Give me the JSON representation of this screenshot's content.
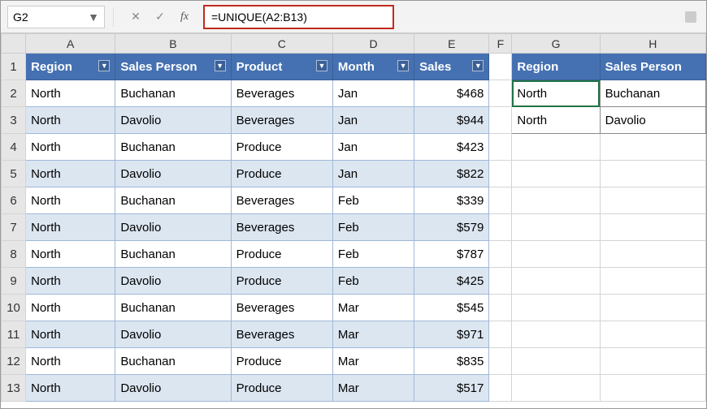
{
  "formula_bar": {
    "active_cell": "G2",
    "formula": "=UNIQUE(A2:B13)",
    "fx_label": "fx"
  },
  "columns": [
    "A",
    "B",
    "C",
    "D",
    "E",
    "F",
    "G",
    "H"
  ],
  "table1_headers": {
    "a": "Region",
    "b": "Sales Person",
    "c": "Product",
    "d": "Month",
    "e": "Sales"
  },
  "table2_headers": {
    "g": "Region",
    "h": "Sales Person"
  },
  "rows": [
    {
      "n": 2,
      "a": "North",
      "b": "Buchanan",
      "c": "Beverages",
      "d": "Jan",
      "e": "$468",
      "g": "North",
      "h": "Buchanan"
    },
    {
      "n": 3,
      "a": "North",
      "b": "Davolio",
      "c": "Beverages",
      "d": "Jan",
      "e": "$944",
      "g": "North",
      "h": "Davolio"
    },
    {
      "n": 4,
      "a": "North",
      "b": "Buchanan",
      "c": "Produce",
      "d": "Jan",
      "e": "$423",
      "g": "",
      "h": ""
    },
    {
      "n": 5,
      "a": "North",
      "b": "Davolio",
      "c": "Produce",
      "d": "Jan",
      "e": "$822",
      "g": "",
      "h": ""
    },
    {
      "n": 6,
      "a": "North",
      "b": "Buchanan",
      "c": "Beverages",
      "d": "Feb",
      "e": "$339",
      "g": "",
      "h": ""
    },
    {
      "n": 7,
      "a": "North",
      "b": "Davolio",
      "c": "Beverages",
      "d": "Feb",
      "e": "$579",
      "g": "",
      "h": ""
    },
    {
      "n": 8,
      "a": "North",
      "b": "Buchanan",
      "c": "Produce",
      "d": "Feb",
      "e": "$787",
      "g": "",
      "h": ""
    },
    {
      "n": 9,
      "a": "North",
      "b": "Davolio",
      "c": "Produce",
      "d": "Feb",
      "e": "$425",
      "g": "",
      "h": ""
    },
    {
      "n": 10,
      "a": "North",
      "b": "Buchanan",
      "c": "Beverages",
      "d": "Mar",
      "e": "$545",
      "g": "",
      "h": ""
    },
    {
      "n": 11,
      "a": "North",
      "b": "Davolio",
      "c": "Beverages",
      "d": "Mar",
      "e": "$971",
      "g": "",
      "h": ""
    },
    {
      "n": 12,
      "a": "North",
      "b": "Buchanan",
      "c": "Produce",
      "d": "Mar",
      "e": "$835",
      "g": "",
      "h": ""
    },
    {
      "n": 13,
      "a": "North",
      "b": "Davolio",
      "c": "Produce",
      "d": "Mar",
      "e": "$517",
      "g": "",
      "h": ""
    }
  ]
}
